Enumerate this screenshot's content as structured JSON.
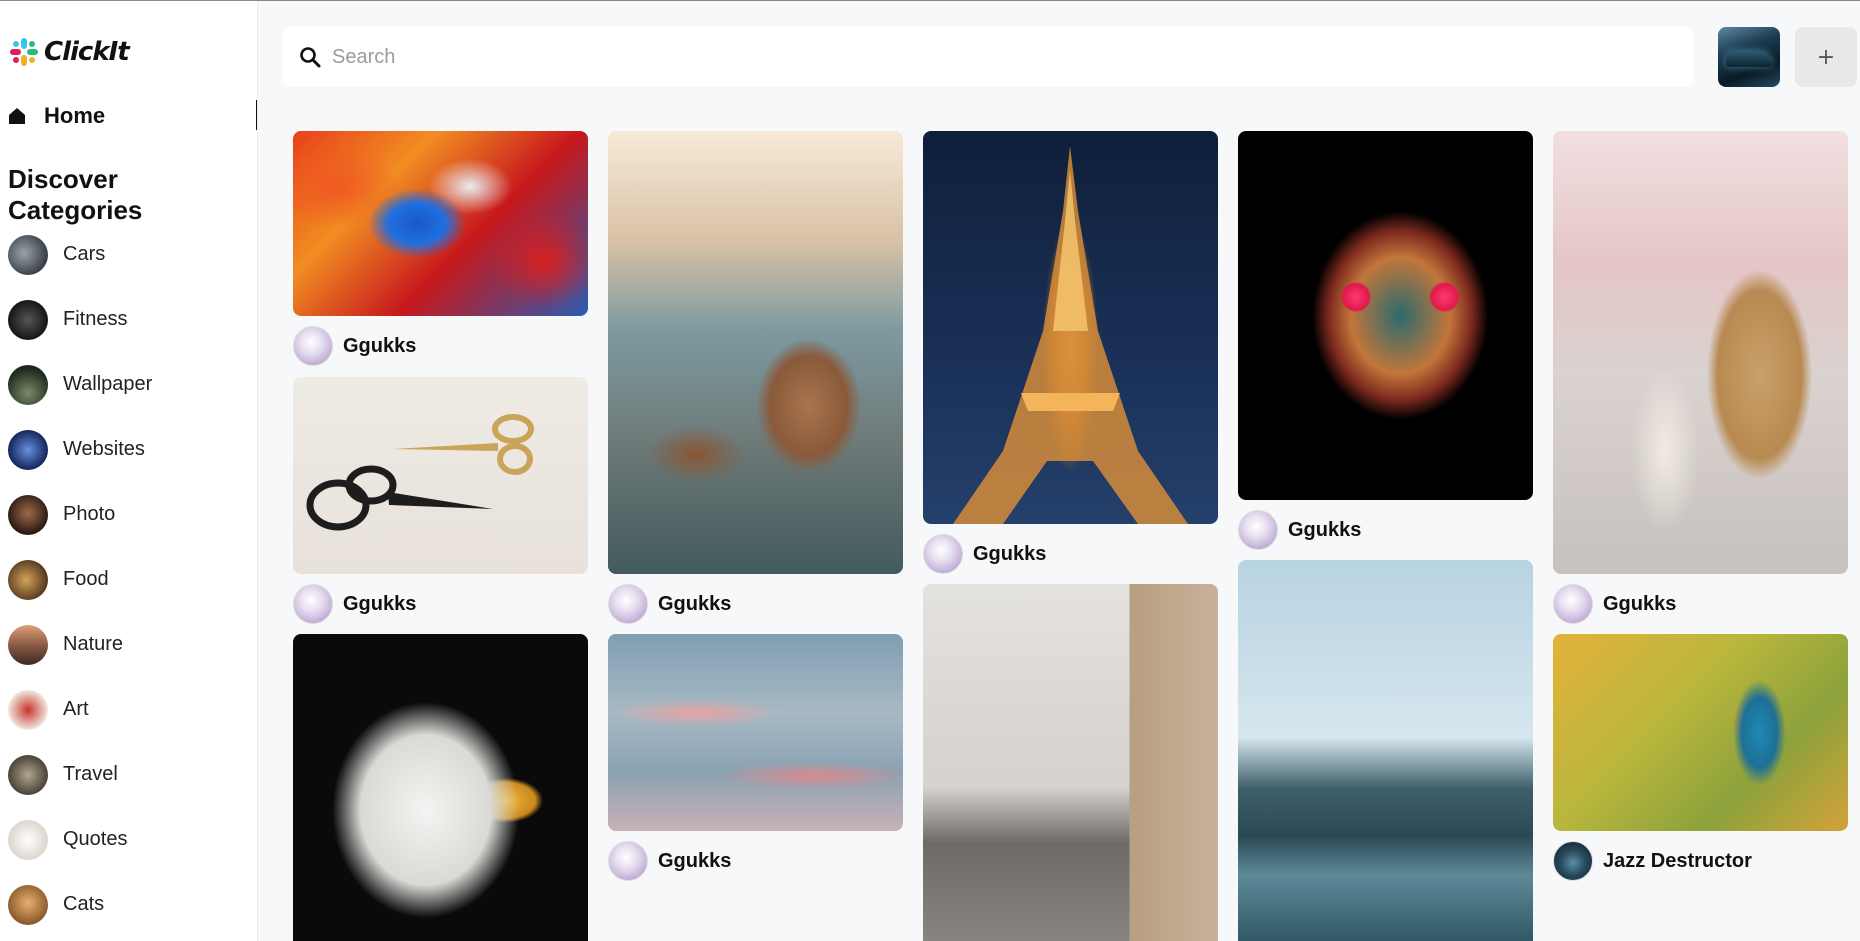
{
  "app": {
    "name": "ClickIt"
  },
  "sidebar": {
    "home_label": "Home",
    "categories_title": "Discover Categories",
    "categories": [
      {
        "label": "Cars",
        "color": "#5a6470"
      },
      {
        "label": "Fitness",
        "color": "#2b2b2b"
      },
      {
        "label": "Wallpaper",
        "color": "#2f3a2a"
      },
      {
        "label": "Websites",
        "color": "#1f3b78"
      },
      {
        "label": "Photo",
        "color": "#3a2a22"
      },
      {
        "label": "Food",
        "color": "#9a6a3a"
      },
      {
        "label": "Nature",
        "color": "#6a4a3a"
      },
      {
        "label": "Art",
        "color": "#c84a3a"
      },
      {
        "label": "Travel",
        "color": "#7a7466"
      },
      {
        "label": "Quotes",
        "color": "#e9e4dc"
      },
      {
        "label": "Cats",
        "color": "#c98a44"
      }
    ]
  },
  "search": {
    "placeholder": "Search"
  },
  "toolbar": {
    "add_label": "+"
  },
  "pins": [
    {
      "author": "Ggukks",
      "image": "abstract-painting"
    },
    {
      "author": "Ggukks",
      "image": "scissors"
    },
    {
      "author": "",
      "image": "eagle"
    },
    {
      "author": "Ggukks",
      "image": "teddy-bear-shoes"
    },
    {
      "author": "Ggukks",
      "image": "sunset-clouds"
    },
    {
      "author": "Ggukks",
      "image": "eiffel-tower"
    },
    {
      "author": "",
      "image": "living-room"
    },
    {
      "author": "Ggukks",
      "image": "sugar-skull"
    },
    {
      "author": "",
      "image": "mountain-lake"
    },
    {
      "author": "Ggukks",
      "image": "girl-with-teddy"
    },
    {
      "author": "Jazz Destructor",
      "image": "kingfisher"
    }
  ]
}
